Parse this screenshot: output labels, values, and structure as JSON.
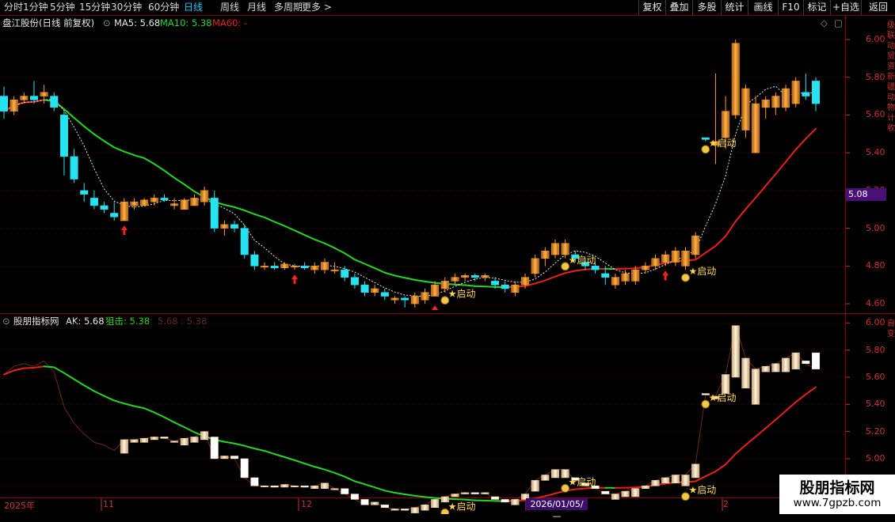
{
  "top_tabs": [
    "分时",
    "1分钟",
    "5分钟",
    "15分钟",
    "30分钟",
    "60分钟",
    "日线",
    "周线",
    "月线",
    "多周期",
    "更多 >"
  ],
  "active_tab": "日线",
  "top_buttons": [
    "复权",
    "叠加",
    "多股",
    "统计",
    "画线",
    "F10",
    "标记",
    "+自选",
    "返回"
  ],
  "main": {
    "title": "盘江股份(日线 前复权)",
    "ma5_label": "MA5: 5.68",
    "ma10_label": "MA10: 5.38",
    "ma60_label": "MA60: -",
    "price_axis": [
      "6.00",
      "5.80",
      "5.60",
      "5.40",
      "5.20",
      "5.00",
      "4.80",
      "4.60"
    ],
    "current_price": "5.08",
    "signal_text": "★启动",
    "vertical_text": "级联动贸资新疆动物计收"
  },
  "sub": {
    "title": "股朋指标网",
    "ak_label": "AK: 5.68",
    "ju_label": "狙击: 5.38",
    "gray_label": "5.68 : 5.38",
    "price_axis": [
      "6.00",
      "5.80",
      "5.60",
      "5.40",
      "5.20",
      "5.00",
      "4.80"
    ],
    "signal_text": "★启动",
    "vertical_text": "自变"
  },
  "dates": {
    "year": "2025年",
    "m11": "11",
    "m12": "12",
    "selected": "2026/01/05/—",
    "m2": "2"
  },
  "watermark": {
    "title": "股朋指标网",
    "url": "www.7gpzb.com"
  },
  "colors": {
    "up": "#ff9a1f",
    "down": "#27e2f0",
    "ma_up": "#e8201c",
    "ma_down": "#22d622",
    "grid": "#5a0000",
    "axis": "#cc3333"
  },
  "chart_data": {
    "type": "candlestick",
    "title": "盘江股份(日线 前复权)",
    "series_ohlc": [
      [
        5.7,
        5.75,
        5.58,
        5.62
      ],
      [
        5.62,
        5.7,
        5.6,
        5.68
      ],
      [
        5.68,
        5.72,
        5.66,
        5.7
      ],
      [
        5.7,
        5.78,
        5.66,
        5.68
      ],
      [
        5.7,
        5.76,
        5.66,
        5.72
      ],
      [
        5.7,
        5.72,
        5.62,
        5.64
      ],
      [
        5.6,
        5.62,
        5.28,
        5.38
      ],
      [
        5.38,
        5.42,
        5.24,
        5.26
      ],
      [
        5.2,
        5.24,
        5.14,
        5.18
      ],
      [
        5.16,
        5.2,
        5.1,
        5.12
      ],
      [
        5.12,
        5.14,
        5.08,
        5.1
      ],
      [
        5.08,
        5.14,
        5.04,
        5.06
      ],
      [
        5.04,
        5.16,
        5.04,
        5.14
      ],
      [
        5.12,
        5.16,
        5.1,
        5.14
      ],
      [
        5.12,
        5.16,
        5.12,
        5.15
      ],
      [
        5.14,
        5.18,
        5.12,
        5.16
      ],
      [
        5.16,
        5.18,
        5.14,
        5.15
      ],
      [
        5.12,
        5.16,
        5.1,
        5.13
      ],
      [
        5.1,
        5.16,
        5.1,
        5.15
      ],
      [
        5.12,
        5.18,
        5.12,
        5.16
      ],
      [
        5.14,
        5.22,
        5.12,
        5.2
      ],
      [
        5.16,
        5.2,
        4.98,
        5.0
      ],
      [
        5.0,
        5.04,
        4.96,
        5.02
      ],
      [
        5.02,
        5.04,
        4.98,
        5.0
      ],
      [
        5.0,
        5.02,
        4.84,
        4.86
      ],
      [
        4.86,
        4.88,
        4.78,
        4.8
      ],
      [
        4.8,
        4.82,
        4.78,
        4.8
      ],
      [
        4.8,
        4.82,
        4.78,
        4.79
      ],
      [
        4.79,
        4.82,
        4.78,
        4.81
      ],
      [
        4.8,
        4.81,
        4.78,
        4.8
      ],
      [
        4.8,
        4.82,
        4.78,
        4.79
      ],
      [
        4.78,
        4.82,
        4.76,
        4.8
      ],
      [
        4.78,
        4.84,
        4.76,
        4.82
      ],
      [
        4.78,
        4.82,
        4.76,
        4.78
      ],
      [
        4.78,
        4.8,
        4.72,
        4.74
      ],
      [
        4.74,
        4.76,
        4.68,
        4.7
      ],
      [
        4.7,
        4.72,
        4.64,
        4.66
      ],
      [
        4.66,
        4.7,
        4.64,
        4.68
      ],
      [
        4.66,
        4.68,
        4.62,
        4.64
      ],
      [
        4.62,
        4.64,
        4.6,
        4.63
      ],
      [
        4.63,
        4.64,
        4.58,
        4.62
      ],
      [
        4.6,
        4.66,
        4.58,
        4.64
      ],
      [
        4.62,
        4.68,
        4.6,
        4.66
      ],
      [
        4.64,
        4.72,
        4.64,
        4.7
      ],
      [
        4.68,
        4.74,
        4.66,
        4.72
      ],
      [
        4.72,
        4.76,
        4.7,
        4.74
      ],
      [
        4.74,
        4.76,
        4.72,
        4.75
      ],
      [
        4.75,
        4.76,
        4.72,
        4.74
      ],
      [
        4.74,
        4.76,
        4.72,
        4.75
      ],
      [
        4.72,
        4.74,
        4.68,
        4.7
      ],
      [
        4.7,
        4.72,
        4.66,
        4.68
      ],
      [
        4.66,
        4.72,
        4.64,
        4.7
      ],
      [
        4.7,
        4.76,
        4.68,
        4.74
      ],
      [
        4.76,
        4.86,
        4.74,
        4.84
      ],
      [
        4.84,
        4.9,
        4.8,
        4.88
      ],
      [
        4.86,
        4.94,
        4.84,
        4.92
      ],
      [
        4.86,
        4.94,
        4.84,
        4.92
      ],
      [
        4.86,
        4.88,
        4.82,
        4.84
      ],
      [
        4.82,
        4.84,
        4.78,
        4.8
      ],
      [
        4.8,
        4.82,
        4.76,
        4.78
      ],
      [
        4.76,
        4.8,
        4.7,
        4.74
      ],
      [
        4.7,
        4.76,
        4.68,
        4.74
      ],
      [
        4.72,
        4.78,
        4.7,
        4.76
      ],
      [
        4.72,
        4.8,
        4.7,
        4.78
      ],
      [
        4.78,
        4.82,
        4.76,
        4.8
      ],
      [
        4.8,
        4.86,
        4.78,
        4.84
      ],
      [
        4.82,
        4.88,
        4.8,
        4.86
      ],
      [
        4.82,
        4.9,
        4.8,
        4.88
      ],
      [
        4.8,
        4.9,
        4.78,
        4.88
      ],
      [
        4.86,
        4.98,
        4.84,
        4.96
      ],
      [
        5.48,
        5.48,
        5.46,
        5.47
      ],
      [
        5.44,
        5.82,
        5.34,
        5.46
      ],
      [
        5.48,
        5.7,
        5.42,
        5.62
      ],
      [
        5.6,
        6.0,
        5.58,
        5.98
      ],
      [
        5.52,
        5.76,
        5.48,
        5.74
      ],
      [
        5.4,
        5.7,
        5.4,
        5.66
      ],
      [
        5.64,
        5.7,
        5.58,
        5.68
      ],
      [
        5.64,
        5.72,
        5.6,
        5.7
      ],
      [
        5.64,
        5.76,
        5.62,
        5.74
      ],
      [
        5.66,
        5.8,
        5.64,
        5.78
      ],
      [
        5.72,
        5.82,
        5.68,
        5.7
      ],
      [
        5.78,
        5.8,
        5.62,
        5.66
      ]
    ],
    "ma_values_end": {
      "MA5": 5.68,
      "MA10": 5.38
    },
    "y_range": [
      4.55,
      6.05
    ],
    "sub_y_range": [
      4.72,
      6.06
    ],
    "signal_label": "★启动"
  }
}
